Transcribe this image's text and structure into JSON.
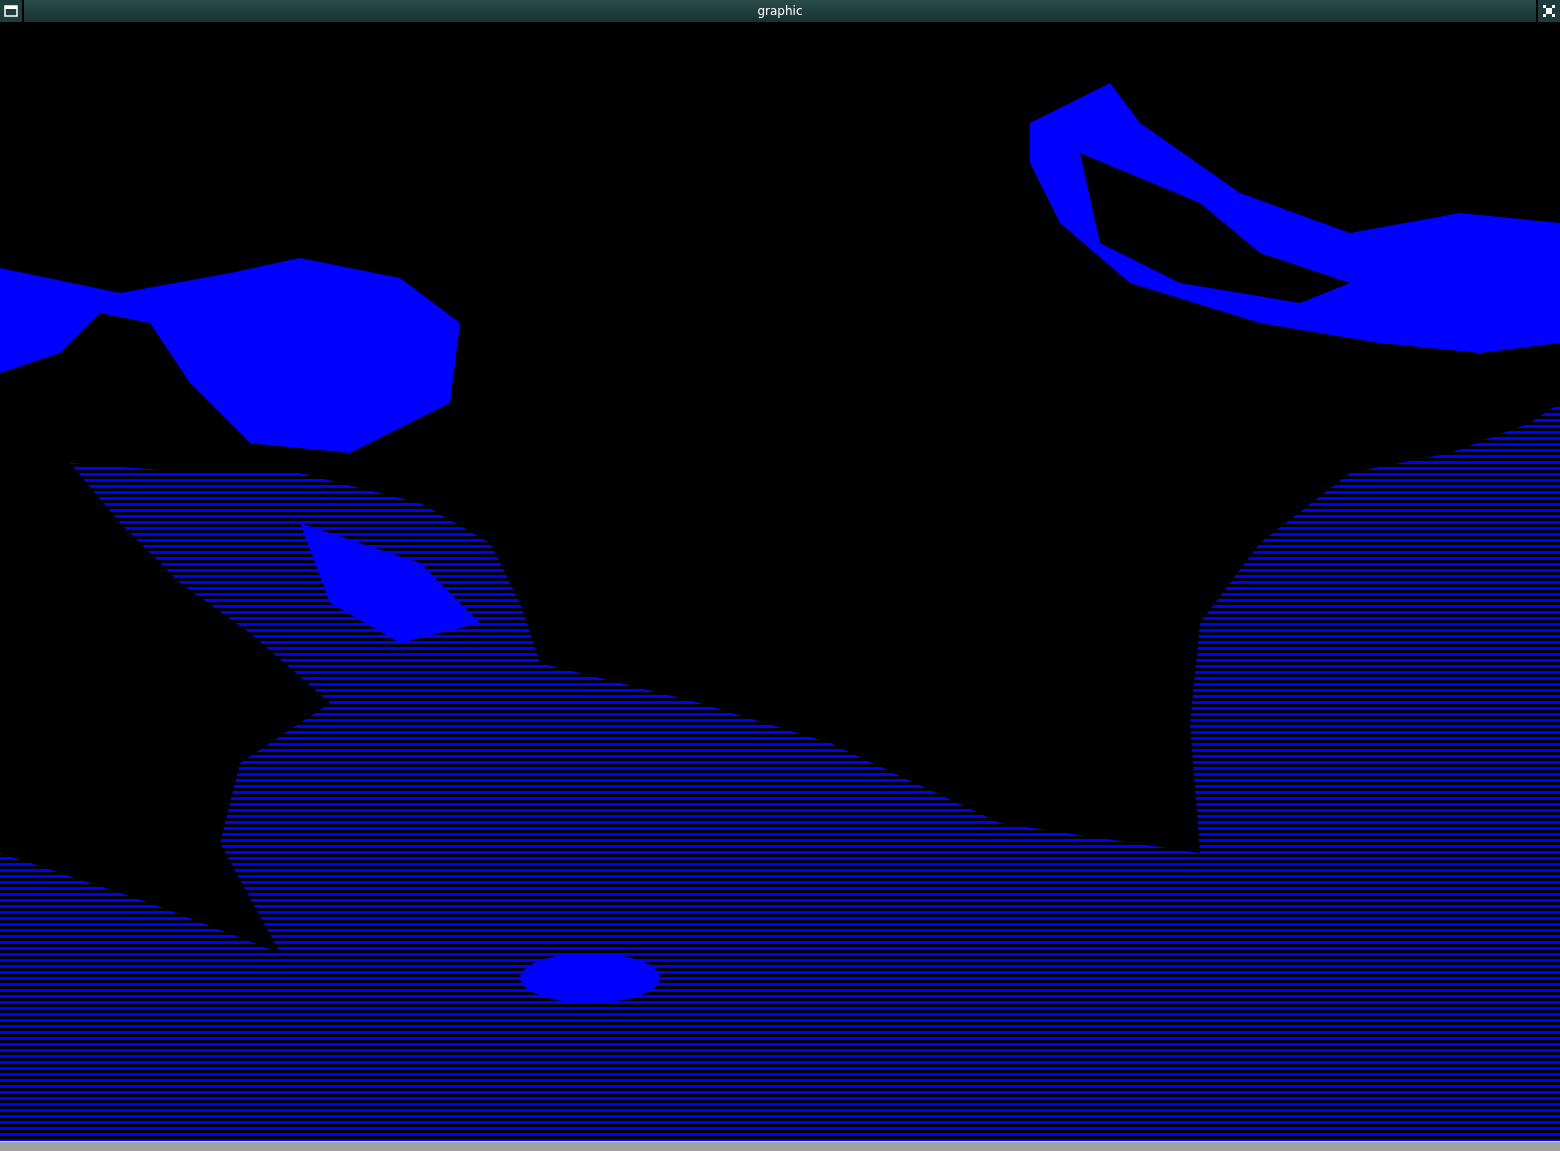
{
  "window": {
    "title": "graphic"
  }
}
